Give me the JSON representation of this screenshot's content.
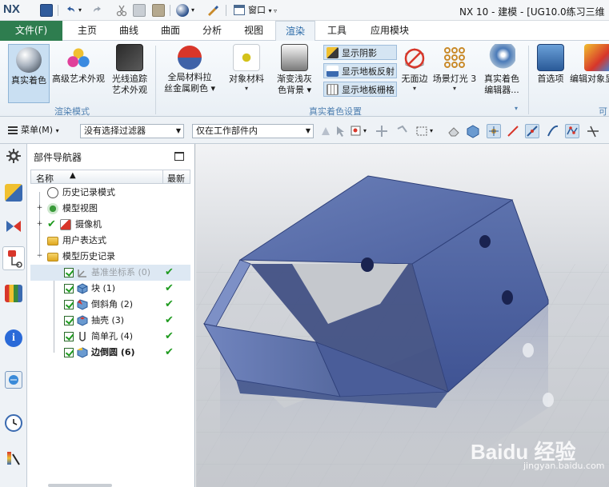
{
  "app": {
    "logo": "NX",
    "title": "NX 10 - 建模 - [UG10.0练习三维",
    "window_menu": "窗口"
  },
  "tabs": {
    "file": "文件(F)",
    "items": [
      "主页",
      "曲线",
      "曲面",
      "分析",
      "视图",
      "渲染",
      "工具",
      "应用模块"
    ],
    "active": "渲染"
  },
  "ribbon": {
    "buttons": [
      {
        "label1": "真实着色",
        "label2": "",
        "selected": true
      },
      {
        "label1": "高级艺术外观",
        "label2": ""
      },
      {
        "label1": "光线追踪",
        "label2": "艺术外观"
      },
      {
        "label1": "全局材料拉",
        "label2": "丝金属刷色"
      },
      {
        "label1": "对象材料",
        "label2": ""
      },
      {
        "label1": "渐变浅灰",
        "label2": "色背景"
      },
      {
        "label1": "无面边",
        "label2": ""
      },
      {
        "label1": "场景灯光 3",
        "label2": ""
      },
      {
        "label1": "真实着色",
        "label2": "编辑器..."
      },
      {
        "label1": "首选项",
        "label2": ""
      },
      {
        "label1": "编辑对象显",
        "label2": ""
      }
    ],
    "toggles": [
      "显示阴影",
      "显示地板反射",
      "显示地板栅格"
    ],
    "groups": [
      "渲染模式",
      "真实着色设置",
      "可"
    ]
  },
  "selection_bar": {
    "menu": "菜单(M)",
    "filter": "没有选择过滤器",
    "scope": "仅在工作部件内"
  },
  "navigator": {
    "title": "部件导航器",
    "col_name": "名称",
    "col_latest": "最新",
    "sort_glyph": "▲",
    "rows": [
      {
        "label": "历史记录模式"
      },
      {
        "label": "模型视图"
      },
      {
        "label": "摄像机"
      },
      {
        "label": "用户表达式"
      },
      {
        "label": "模型历史记录"
      },
      {
        "label": "基准坐标系 (0)"
      },
      {
        "label": "块 (1)"
      },
      {
        "label": "倒斜角 (2)"
      },
      {
        "label": "抽壳 (3)"
      },
      {
        "label": "简单孔 (4)"
      },
      {
        "label": "边倒圆 (6)"
      }
    ],
    "check_glyph": "✔"
  },
  "watermark": {
    "brand": "Baidu 经验",
    "url": "jingyan.baidu.com"
  },
  "colors": {
    "file_tab": "#2e7d4f",
    "accent": "#2a6aa8",
    "part_blue": "#5a6fa8",
    "check_green": "#1e9a1e"
  }
}
